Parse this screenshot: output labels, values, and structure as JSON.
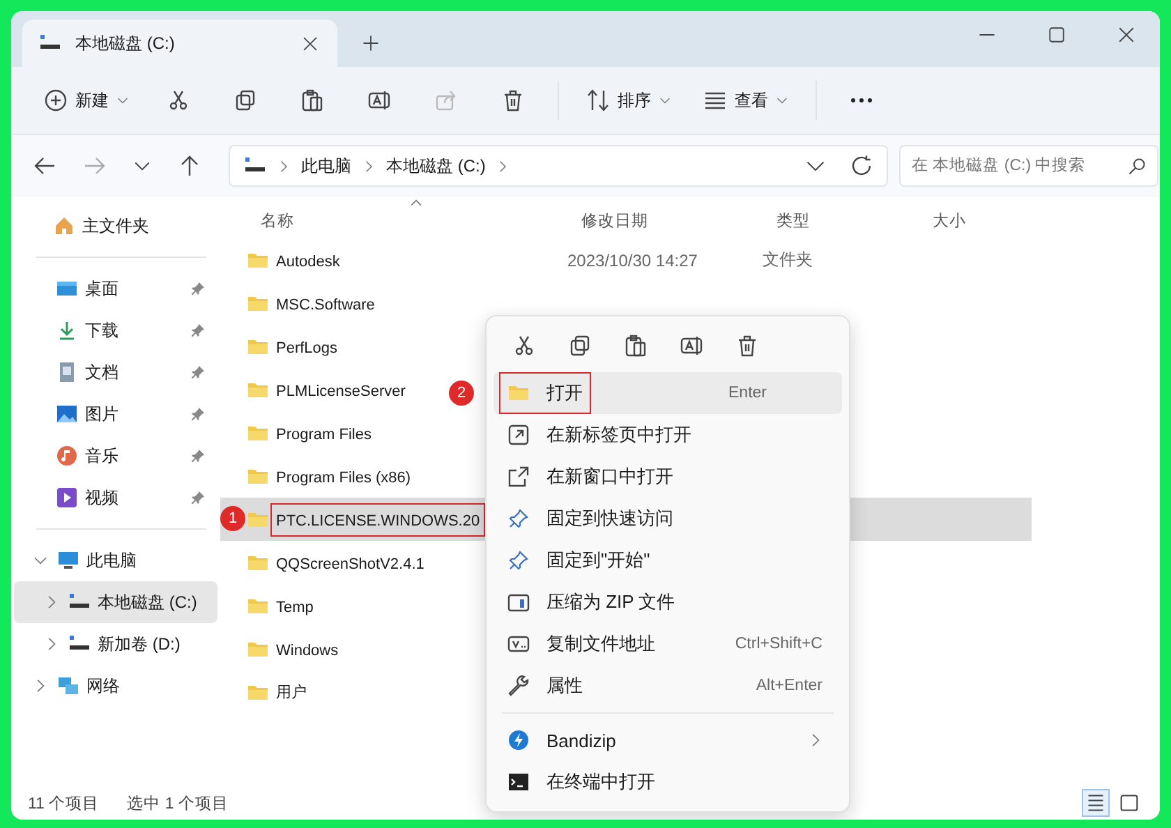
{
  "window": {
    "tab_title": "本地磁盘 (C:)"
  },
  "toolbar": {
    "new_label": "新建",
    "sort_label": "排序",
    "view_label": "查看"
  },
  "address": {
    "crumbs": [
      "此电脑",
      "本地磁盘 (C:)"
    ],
    "search_placeholder": "在 本地磁盘 (C:) 中搜索"
  },
  "sidebar": {
    "home": {
      "label": "主文件夹"
    },
    "quick": [
      {
        "label": "桌面",
        "pinned": true
      },
      {
        "label": "下载",
        "pinned": true
      },
      {
        "label": "文档",
        "pinned": true
      },
      {
        "label": "图片",
        "pinned": true
      },
      {
        "label": "音乐",
        "pinned": true
      },
      {
        "label": "视频",
        "pinned": true
      }
    ],
    "tree": [
      {
        "label": "此电脑",
        "expanded": true,
        "selected": false,
        "children": [
          {
            "label": "本地磁盘 (C:)",
            "expanded": false,
            "selected": true
          },
          {
            "label": "新加卷 (D:)",
            "expanded": false,
            "selected": false
          }
        ]
      },
      {
        "label": "网络",
        "expanded": false,
        "selected": false
      }
    ]
  },
  "table": {
    "columns": [
      "名称",
      "修改日期",
      "类型",
      "大小"
    ],
    "rows": [
      {
        "name": "Autodesk",
        "date": "2023/10/30 14:27",
        "type": "文件夹",
        "selected": false
      },
      {
        "name": "MSC.Software",
        "selected": false
      },
      {
        "name": "PerfLogs",
        "selected": false
      },
      {
        "name": "PLMLicenseServer",
        "selected": false
      },
      {
        "name": "Program Files",
        "selected": false
      },
      {
        "name": "Program Files (x86)",
        "selected": false
      },
      {
        "name": "PTC.LICENSE.WINDOWS.20",
        "selected": true,
        "annotation": "1"
      },
      {
        "name": "QQScreenShotV2.4.1",
        "selected": false
      },
      {
        "name": "Temp",
        "selected": false
      },
      {
        "name": "Windows",
        "selected": false
      },
      {
        "name": "用户",
        "selected": false
      }
    ]
  },
  "context_menu": {
    "groups": [
      [
        {
          "label": "打开",
          "shortcut": "Enter",
          "highlighted": true,
          "annotation": "2"
        },
        {
          "label": "在新标签页中打开",
          "highlighted": false
        },
        {
          "label": "在新窗口中打开",
          "highlighted": false
        },
        {
          "label": "固定到快速访问",
          "highlighted": false
        },
        {
          "label": "固定到\"开始\"",
          "highlighted": false
        },
        {
          "label": "压缩为 ZIP 文件",
          "highlighted": false
        },
        {
          "label": "复制文件地址",
          "shortcut": "Ctrl+Shift+C",
          "highlighted": false
        },
        {
          "label": "属性",
          "shortcut": "Alt+Enter",
          "highlighted": false
        }
      ],
      [
        {
          "label": "Bandizip",
          "highlighted": false,
          "has_submenu": true
        },
        {
          "label": "在终端中打开",
          "highlighted": false
        }
      ]
    ]
  },
  "status_bar": {
    "count": "11 个项目",
    "selection": "选中 1 个项目",
    "details_view": true
  }
}
